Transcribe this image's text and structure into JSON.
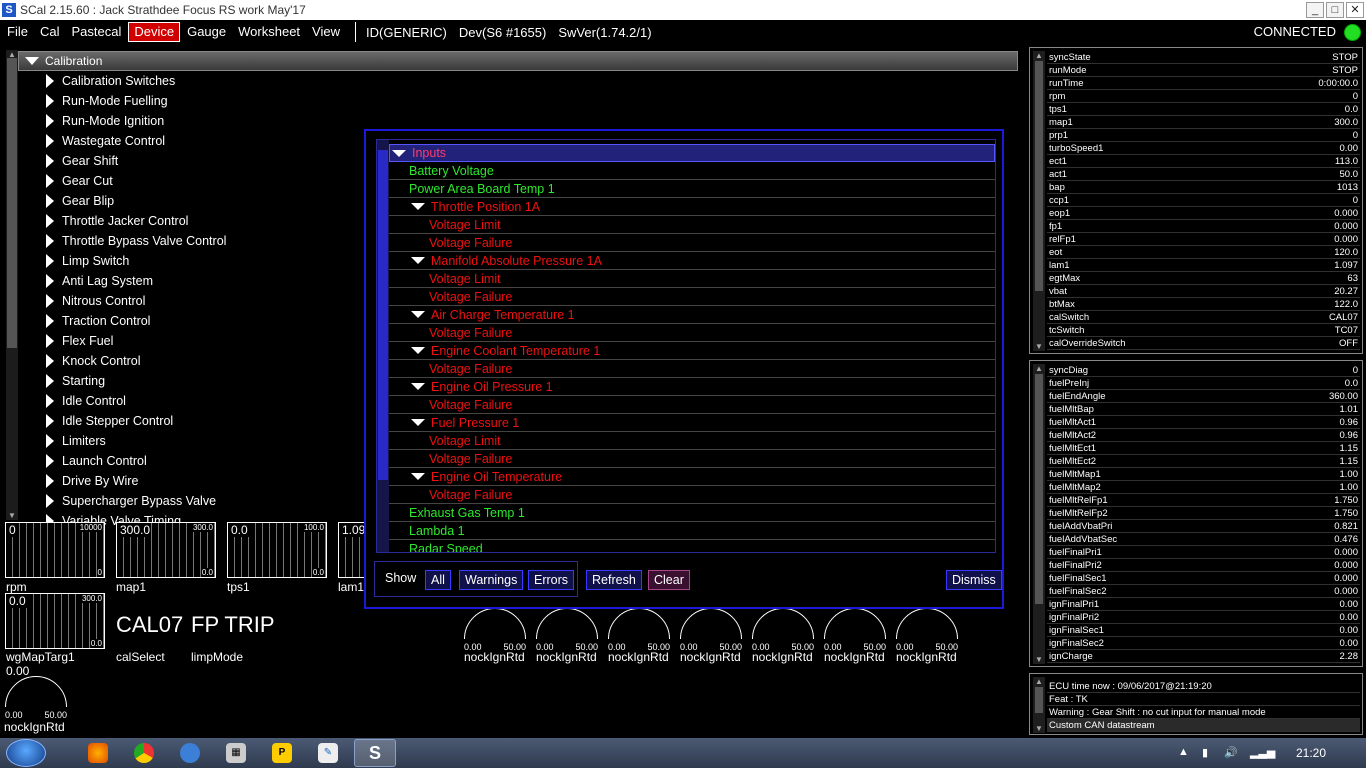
{
  "window": {
    "title": "SCal 2.15.60  :  Jack Strathdee Focus RS work May'17",
    "app_icon": "S",
    "min": "_",
    "max": "□",
    "close": "✕"
  },
  "menu": {
    "file": "File",
    "cal": "Cal",
    "pastecal": "Pastecal",
    "device": "Device",
    "gauge": "Gauge",
    "worksheet": "Worksheet",
    "view": "View",
    "id": "ID(GENERIC)",
    "dev": "Dev(S6 #1655)",
    "swver": "SwVer(1.74.2/1)",
    "status": "CONNECTED",
    "status_color": "#22dd22"
  },
  "tree": {
    "root": "Calibration",
    "items": [
      "Calibration Switches",
      "Run-Mode Fuelling",
      "Run-Mode Ignition",
      "Wastegate Control",
      "Gear Shift",
      "Gear Cut",
      "Gear Blip",
      "Throttle Jacker Control",
      "Throttle Bypass Valve Control",
      "Limp Switch",
      "Anti Lag System",
      "Nitrous Control",
      "Traction Control",
      "Flex Fuel",
      "Knock Control",
      "Starting",
      "Idle Control",
      "Idle Stepper Control",
      "Limiters",
      "Launch Control",
      "Drive By Wire",
      "Supercharger Bypass Valve",
      "Variable Valve Timing"
    ]
  },
  "gauges": {
    "rpm": {
      "value": "0",
      "max": "10000",
      "min": "0",
      "label": "rpm"
    },
    "map1": {
      "value": "300.0",
      "max": "300.0",
      "min": "0.0",
      "label": "map1"
    },
    "tps1": {
      "value": "0.0",
      "max": "100.0",
      "min": "0.0",
      "label": "tps1"
    },
    "lam1": {
      "value": "1.09",
      "label": "lam1"
    },
    "wgMapTarg1": {
      "value": "0.0",
      "max": "300.0",
      "min": "0.0",
      "label": "wgMapTarg1"
    },
    "calSelect": {
      "value": "CAL07",
      "label": "calSelect"
    },
    "limpMode": {
      "value": "FP TRIP",
      "label": "limpMode"
    },
    "knock_left": {
      "value": "0.00",
      "min": "0.00",
      "max": "50.00",
      "label": "nockIgnRtd"
    },
    "knock_dials": [
      {
        "min": "0.00",
        "max": "50.00",
        "label": "nockIgnRtd"
      },
      {
        "min": "0.00",
        "max": "50.00",
        "label": "nockIgnRtd"
      },
      {
        "min": "0.00",
        "max": "50.00",
        "label": "nockIgnRtd"
      },
      {
        "min": "0.00",
        "max": "50.00",
        "label": "nockIgnRtd"
      },
      {
        "min": "0.00",
        "max": "50.00",
        "label": "nockIgnRtd"
      },
      {
        "min": "0.00",
        "max": "50.00",
        "label": "nockIgnRtd"
      },
      {
        "min": "0.00",
        "max": "50.00",
        "label": "nockIgnRtd"
      }
    ]
  },
  "dialog": {
    "rows": [
      {
        "text": "Inputs",
        "color": "pink",
        "level": 0,
        "expanded": true
      },
      {
        "text": "Battery Voltage",
        "color": "green",
        "level": 1
      },
      {
        "text": "Power Area Board Temp 1",
        "color": "green",
        "level": 1
      },
      {
        "text": "Throttle Position 1A",
        "color": "red",
        "level": 1,
        "expanded": true
      },
      {
        "text": "Voltage Limit",
        "color": "red",
        "level": 2
      },
      {
        "text": "Voltage Failure",
        "color": "red",
        "level": 2
      },
      {
        "text": "Manifold Absolute Pressure 1A",
        "color": "red",
        "level": 1,
        "expanded": true
      },
      {
        "text": "Voltage Limit",
        "color": "red",
        "level": 2
      },
      {
        "text": "Voltage Failure",
        "color": "red",
        "level": 2
      },
      {
        "text": "Air Charge Temperature 1",
        "color": "red",
        "level": 1,
        "expanded": true
      },
      {
        "text": "Voltage Failure",
        "color": "red",
        "level": 2
      },
      {
        "text": "Engine Coolant Temperature 1",
        "color": "red",
        "level": 1,
        "expanded": true
      },
      {
        "text": "Voltage Failure",
        "color": "red",
        "level": 2
      },
      {
        "text": "Engine Oil Pressure 1",
        "color": "red",
        "level": 1,
        "expanded": true
      },
      {
        "text": "Voltage Failure",
        "color": "red",
        "level": 2
      },
      {
        "text": "Fuel Pressure 1",
        "color": "red",
        "level": 1,
        "expanded": true
      },
      {
        "text": "Voltage Limit",
        "color": "red",
        "level": 2
      },
      {
        "text": "Voltage Failure",
        "color": "red",
        "level": 2
      },
      {
        "text": "Engine Oil Temperature",
        "color": "red",
        "level": 1,
        "expanded": true
      },
      {
        "text": "Voltage Failure",
        "color": "red",
        "level": 2
      },
      {
        "text": "Exhaust Gas Temp 1",
        "color": "green",
        "level": 1
      },
      {
        "text": "Lambda 1",
        "color": "green",
        "level": 1
      },
      {
        "text": "Radar Speed",
        "color": "green",
        "level": 1
      }
    ],
    "show_label": "Show",
    "all": "All",
    "warnings": "Warnings",
    "errors": "Errors",
    "refresh": "Refresh",
    "clear": "Clear",
    "dismiss": "Dismiss"
  },
  "panel1": [
    {
      "k": "syncState",
      "v": "STOP"
    },
    {
      "k": "runMode",
      "v": "STOP"
    },
    {
      "k": "runTime",
      "v": "0:00:00.0"
    },
    {
      "k": "rpm",
      "v": "0"
    },
    {
      "k": "tps1",
      "v": "0.0"
    },
    {
      "k": "map1",
      "v": "300.0"
    },
    {
      "k": "prp1",
      "v": "0"
    },
    {
      "k": "turboSpeed1",
      "v": "0.00"
    },
    {
      "k": "ect1",
      "v": "113.0"
    },
    {
      "k": "act1",
      "v": "50.0"
    },
    {
      "k": "bap",
      "v": "1013"
    },
    {
      "k": "ccp1",
      "v": "0"
    },
    {
      "k": "eop1",
      "v": "0.000"
    },
    {
      "k": "fp1",
      "v": "0.000"
    },
    {
      "k": "relFp1",
      "v": "0.000"
    },
    {
      "k": "eot",
      "v": "120.0"
    },
    {
      "k": "lam1",
      "v": "1.097"
    },
    {
      "k": "egtMax",
      "v": "63"
    },
    {
      "k": "vbat",
      "v": "20.27"
    },
    {
      "k": "btMax",
      "v": "122.0"
    },
    {
      "k": "calSwitch",
      "v": "CAL07"
    },
    {
      "k": "tcSwitch",
      "v": "TC07"
    },
    {
      "k": "calOverrideSwitch",
      "v": "OFF"
    }
  ],
  "panel2": [
    {
      "k": "syncDiag",
      "v": "0"
    },
    {
      "k": "fuelPreInj",
      "v": "0.0"
    },
    {
      "k": "fuelEndAngle",
      "v": "360.00"
    },
    {
      "k": "fuelMltBap",
      "v": "1.01"
    },
    {
      "k": "fuelMltAct1",
      "v": "0.96"
    },
    {
      "k": "fuelMltAct2",
      "v": "0.96"
    },
    {
      "k": "fuelMltEct1",
      "v": "1.15"
    },
    {
      "k": "fuelMltEct2",
      "v": "1.15"
    },
    {
      "k": "fuelMltMap1",
      "v": "1.00"
    },
    {
      "k": "fuelMltMap2",
      "v": "1.00"
    },
    {
      "k": "fuelMltRelFp1",
      "v": "1.750"
    },
    {
      "k": "fuelMltRelFp2",
      "v": "1.750"
    },
    {
      "k": "fuelAddVbatPri",
      "v": "0.821"
    },
    {
      "k": "fuelAddVbatSec",
      "v": "0.476"
    },
    {
      "k": "fuelFinalPri1",
      "v": "0.000"
    },
    {
      "k": "fuelFinalPri2",
      "v": "0.000"
    },
    {
      "k": "fuelFinalSec1",
      "v": "0.000"
    },
    {
      "k": "fuelFinalSec2",
      "v": "0.000"
    },
    {
      "k": "ignFinalPri1",
      "v": "0.00"
    },
    {
      "k": "ignFinalPri2",
      "v": "0.00"
    },
    {
      "k": "ignFinalSec1",
      "v": "0.00"
    },
    {
      "k": "ignFinalSec2",
      "v": "0.00"
    },
    {
      "k": "ignCharge",
      "v": "2.28"
    }
  ],
  "panel3": [
    "ECU time now : 09/06/2017@21:19:20",
    "Feat : TK",
    "Warning : Gear Shift : no cut input for manual mode",
    "Custom CAN datastream"
  ],
  "taskbar": {
    "clock": "21:20",
    "icons": [
      "firefox-icon",
      "chrome-icon",
      "itunes-icon",
      "calculator-icon",
      "app-p-icon",
      "app-pen-icon",
      "scal-icon"
    ]
  }
}
